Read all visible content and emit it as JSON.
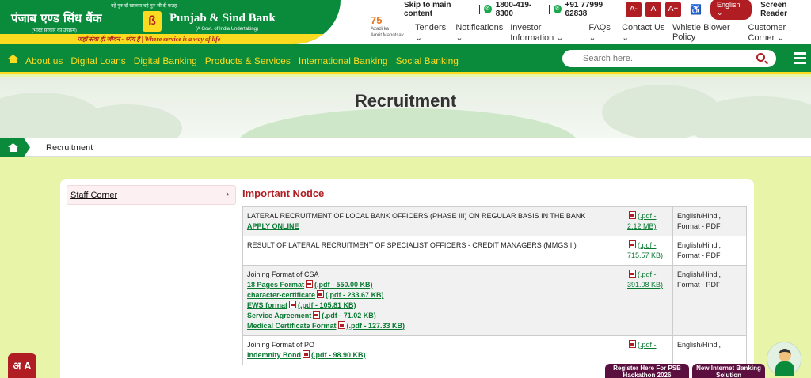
{
  "logo": {
    "top_line": "वहे गुरु दाँ खालसा वहे गुरु जी दी फ़तह",
    "hindi_name": "पंजाब एण्ड सिंध बैंक",
    "hindi_sub": "(भारत सरकार का उपक्रम)",
    "mark": "ß",
    "english_name": "Punjab & Sind Bank",
    "english_sub": "(A Govt. of India Undertaking)",
    "tagline": "जहाँ सेवा ही जीवन - ध्येय है | Where service is a way of life"
  },
  "top_bar": {
    "skip": "Skip to main content",
    "phone1": "1800-419-8300",
    "phone2": "+91 77999 62838",
    "font_small": "A-",
    "font_normal": "A",
    "font_large": "A+",
    "accessibility": "♿",
    "language": "English",
    "screen_reader": "Screen Reader"
  },
  "azadi": {
    "num": "75",
    "line1": "Azadi ka",
    "line2": "Amrit Mahotsav"
  },
  "top_nav": [
    "Tenders",
    "Notifications",
    "Investor Information",
    "FAQs",
    "Contact Us",
    "Whistle Blower Policy",
    "Customer Corner"
  ],
  "main_nav": [
    "About us",
    "Digital Loans",
    "Digital Banking",
    "Products & Services",
    "International Banking",
    "Social Banking"
  ],
  "search": {
    "placeholder": "Search here.."
  },
  "banner": {
    "title": "Recruitment"
  },
  "breadcrumb": {
    "current": "Recruitment"
  },
  "sidebar": {
    "label": "Staff Corner",
    "chevron": "›"
  },
  "section": {
    "title": "Important Notice"
  },
  "notices": {
    "r1": {
      "title": "LATERAL RECRUITMENT OF LOCAL BANK OFFICERS (PHASE III) ON REGULAR BASIS IN THE BANK",
      "link": "APPLY ONLINE",
      "file": "(.pdf - 2.12 MB)",
      "format": "English/Hindi, Format - PDF"
    },
    "r2": {
      "title": "RESULT OF LATERAL RECRUITMENT OF SPECIALIST OFFICERS - CREDIT MANAGERS (MMGS II)",
      "file": "(.pdf - 715.57 KB)",
      "format": "English/Hindi, Format - PDF"
    },
    "r3": {
      "title": "Joining Format of CSA",
      "links": [
        {
          "name": "18 Pages Format",
          "size": "(.pdf - 550.00 KB)"
        },
        {
          "name": "character-certificate",
          "size": "(.pdf - 233.67 KB)"
        },
        {
          "name": "EWS format",
          "size": "(.pdf - 105.81 KB)"
        },
        {
          "name": "Service Agreement",
          "size": "(.pdf - 71.02 KB)"
        },
        {
          "name": "Medical Certificate Format",
          "size": "(.pdf - 127.33 KB)"
        }
      ],
      "file": "(.pdf - 391.08 KB)",
      "format": "English/Hindi, Format - PDF"
    },
    "r4": {
      "title": "Joining Format of PO",
      "link_name": "Indemnity Bond",
      "link_size": "(.pdf - 98.90 KB)",
      "file": "(.pdf -",
      "format": "English/Hindi,"
    }
  },
  "floating": {
    "lang_button": "अ A",
    "pill1": "Register Here For PSB Hackathon 2026",
    "pill2": "New Internet Banking Solution"
  },
  "colors": {
    "brand_green": "#0a8b3c",
    "brand_yellow": "#fbdb1f",
    "brand_red": "#b01e23",
    "page_bg": "#e8f5a8"
  }
}
